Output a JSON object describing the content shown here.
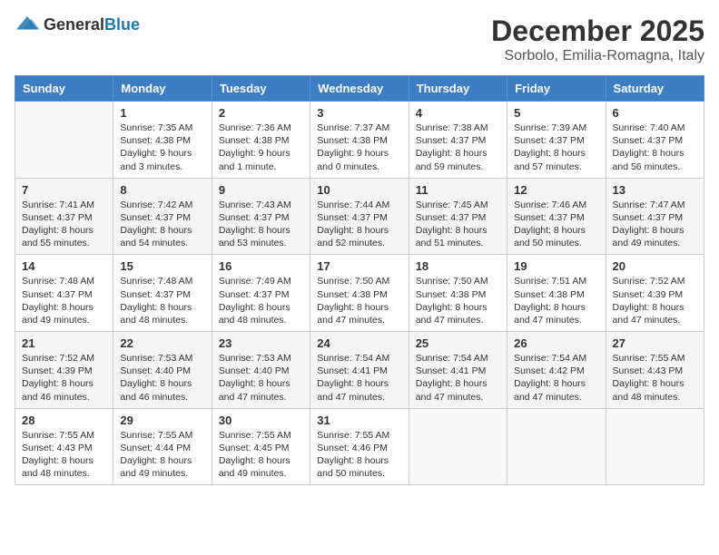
{
  "logo": {
    "general": "General",
    "blue": "Blue"
  },
  "header": {
    "month": "December 2025",
    "location": "Sorbolo, Emilia-Romagna, Italy"
  },
  "days": [
    "Sunday",
    "Monday",
    "Tuesday",
    "Wednesday",
    "Thursday",
    "Friday",
    "Saturday"
  ],
  "weeks": [
    [
      {
        "day": "",
        "content": ""
      },
      {
        "day": "1",
        "content": "Sunrise: 7:35 AM\nSunset: 4:38 PM\nDaylight: 9 hours\nand 3 minutes."
      },
      {
        "day": "2",
        "content": "Sunrise: 7:36 AM\nSunset: 4:38 PM\nDaylight: 9 hours\nand 1 minute."
      },
      {
        "day": "3",
        "content": "Sunrise: 7:37 AM\nSunset: 4:38 PM\nDaylight: 9 hours\nand 0 minutes."
      },
      {
        "day": "4",
        "content": "Sunrise: 7:38 AM\nSunset: 4:37 PM\nDaylight: 8 hours\nand 59 minutes."
      },
      {
        "day": "5",
        "content": "Sunrise: 7:39 AM\nSunset: 4:37 PM\nDaylight: 8 hours\nand 57 minutes."
      },
      {
        "day": "6",
        "content": "Sunrise: 7:40 AM\nSunset: 4:37 PM\nDaylight: 8 hours\nand 56 minutes."
      }
    ],
    [
      {
        "day": "7",
        "content": "Sunrise: 7:41 AM\nSunset: 4:37 PM\nDaylight: 8 hours\nand 55 minutes."
      },
      {
        "day": "8",
        "content": "Sunrise: 7:42 AM\nSunset: 4:37 PM\nDaylight: 8 hours\nand 54 minutes."
      },
      {
        "day": "9",
        "content": "Sunrise: 7:43 AM\nSunset: 4:37 PM\nDaylight: 8 hours\nand 53 minutes."
      },
      {
        "day": "10",
        "content": "Sunrise: 7:44 AM\nSunset: 4:37 PM\nDaylight: 8 hours\nand 52 minutes."
      },
      {
        "day": "11",
        "content": "Sunrise: 7:45 AM\nSunset: 4:37 PM\nDaylight: 8 hours\nand 51 minutes."
      },
      {
        "day": "12",
        "content": "Sunrise: 7:46 AM\nSunset: 4:37 PM\nDaylight: 8 hours\nand 50 minutes."
      },
      {
        "day": "13",
        "content": "Sunrise: 7:47 AM\nSunset: 4:37 PM\nDaylight: 8 hours\nand 49 minutes."
      }
    ],
    [
      {
        "day": "14",
        "content": "Sunrise: 7:48 AM\nSunset: 4:37 PM\nDaylight: 8 hours\nand 49 minutes."
      },
      {
        "day": "15",
        "content": "Sunrise: 7:48 AM\nSunset: 4:37 PM\nDaylight: 8 hours\nand 48 minutes."
      },
      {
        "day": "16",
        "content": "Sunrise: 7:49 AM\nSunset: 4:37 PM\nDaylight: 8 hours\nand 48 minutes."
      },
      {
        "day": "17",
        "content": "Sunrise: 7:50 AM\nSunset: 4:38 PM\nDaylight: 8 hours\nand 47 minutes."
      },
      {
        "day": "18",
        "content": "Sunrise: 7:50 AM\nSunset: 4:38 PM\nDaylight: 8 hours\nand 47 minutes."
      },
      {
        "day": "19",
        "content": "Sunrise: 7:51 AM\nSunset: 4:38 PM\nDaylight: 8 hours\nand 47 minutes."
      },
      {
        "day": "20",
        "content": "Sunrise: 7:52 AM\nSunset: 4:39 PM\nDaylight: 8 hours\nand 47 minutes."
      }
    ],
    [
      {
        "day": "21",
        "content": "Sunrise: 7:52 AM\nSunset: 4:39 PM\nDaylight: 8 hours\nand 46 minutes."
      },
      {
        "day": "22",
        "content": "Sunrise: 7:53 AM\nSunset: 4:40 PM\nDaylight: 8 hours\nand 46 minutes."
      },
      {
        "day": "23",
        "content": "Sunrise: 7:53 AM\nSunset: 4:40 PM\nDaylight: 8 hours\nand 47 minutes."
      },
      {
        "day": "24",
        "content": "Sunrise: 7:54 AM\nSunset: 4:41 PM\nDaylight: 8 hours\nand 47 minutes."
      },
      {
        "day": "25",
        "content": "Sunrise: 7:54 AM\nSunset: 4:41 PM\nDaylight: 8 hours\nand 47 minutes."
      },
      {
        "day": "26",
        "content": "Sunrise: 7:54 AM\nSunset: 4:42 PM\nDaylight: 8 hours\nand 47 minutes."
      },
      {
        "day": "27",
        "content": "Sunrise: 7:55 AM\nSunset: 4:43 PM\nDaylight: 8 hours\nand 48 minutes."
      }
    ],
    [
      {
        "day": "28",
        "content": "Sunrise: 7:55 AM\nSunset: 4:43 PM\nDaylight: 8 hours\nand 48 minutes."
      },
      {
        "day": "29",
        "content": "Sunrise: 7:55 AM\nSunset: 4:44 PM\nDaylight: 8 hours\nand 49 minutes."
      },
      {
        "day": "30",
        "content": "Sunrise: 7:55 AM\nSunset: 4:45 PM\nDaylight: 8 hours\nand 49 minutes."
      },
      {
        "day": "31",
        "content": "Sunrise: 7:55 AM\nSunset: 4:46 PM\nDaylight: 8 hours\nand 50 minutes."
      },
      {
        "day": "",
        "content": ""
      },
      {
        "day": "",
        "content": ""
      },
      {
        "day": "",
        "content": ""
      }
    ]
  ]
}
